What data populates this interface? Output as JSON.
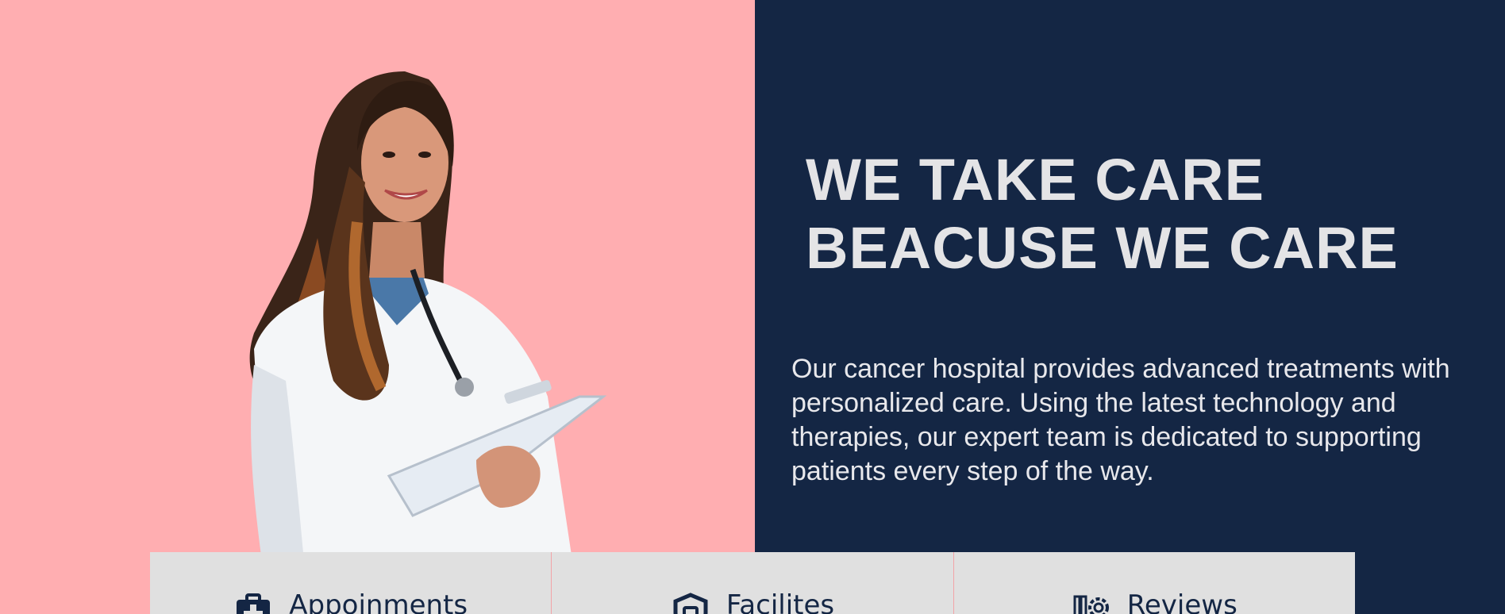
{
  "hero": {
    "title_line1": "WE TAKE CARE",
    "title_line2": "BEACUSE WE CARE",
    "description": "Our cancer hospital provides advanced treatments with personalized care. Using the latest technology and therapies, our expert team is dedicated to supporting patients every step of the way."
  },
  "features": [
    {
      "label": "Appoinments",
      "icon": "medical-kit-icon"
    },
    {
      "label": "Facilites",
      "icon": "shield-icon"
    },
    {
      "label": "Reviews",
      "icon": "gear-tools-icon"
    }
  ],
  "colors": {
    "left_bg": "#ffaeb1",
    "right_bg": "#142644",
    "text_light": "#e4e4e6",
    "feature_bg": "#e0e0e0",
    "feature_text": "#142644"
  }
}
